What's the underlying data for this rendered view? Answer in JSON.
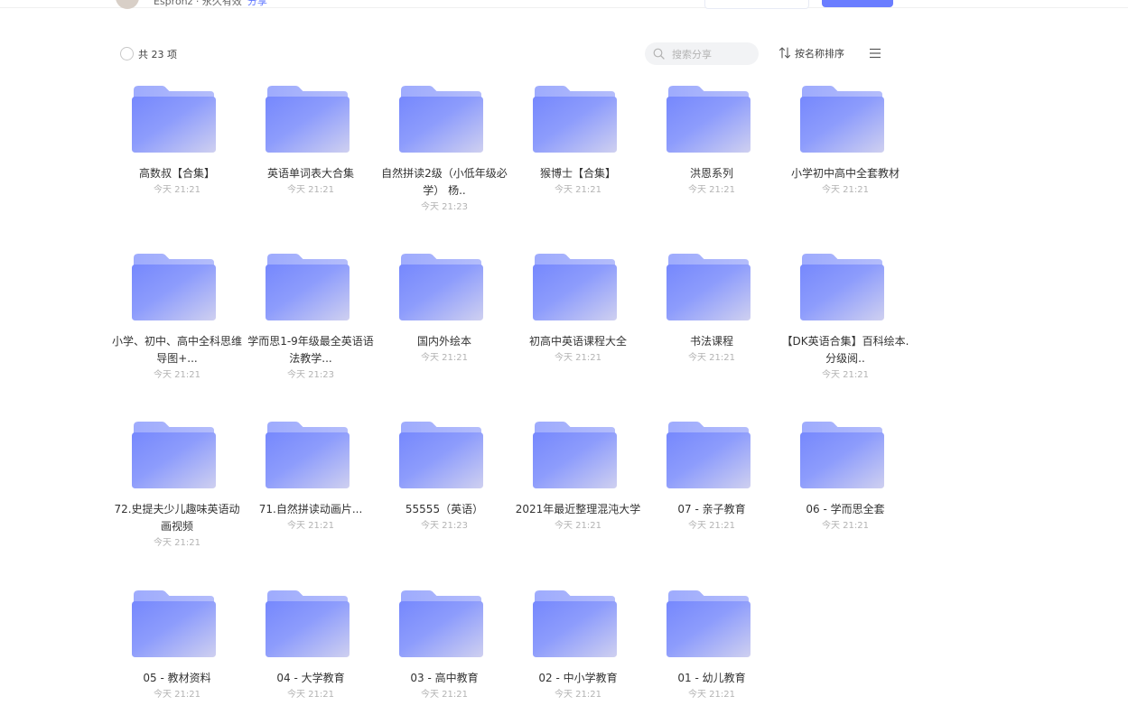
{
  "header": {
    "user_text": "Espronz · 永久有效",
    "link": "分享"
  },
  "toolbar": {
    "count": "共 23 项",
    "search_placeholder": "搜索分享",
    "sort_label": "按名称排序"
  },
  "colors": {
    "accent": "#6a7dff",
    "folder_light": "#a7b3fd",
    "folder_main": "#7e8ffd",
    "folder_end": "#c9cdf2"
  },
  "items": [
    {
      "name": "高数叔【合集】",
      "time": "今天 21:21"
    },
    {
      "name": "英语单词表大合集",
      "time": "今天 21:21"
    },
    {
      "name": "自然拼读2级（小低年级必学） 杨..",
      "time": "今天 21:23"
    },
    {
      "name": "猴博士【合集】",
      "time": "今天 21:21"
    },
    {
      "name": "洪恩系列",
      "time": "今天 21:21"
    },
    {
      "name": "小学初中高中全套教材",
      "time": "今天 21:21"
    },
    {
      "name": "小学、初中、高中全科思维导图+...",
      "time": "今天 21:21"
    },
    {
      "name": "学而思1-9年级最全英语语法教学...",
      "time": "今天 21:23"
    },
    {
      "name": "国内外绘本",
      "time": "今天 21:21"
    },
    {
      "name": "初高中英语课程大全",
      "time": "今天 21:21"
    },
    {
      "name": "书法课程",
      "time": "今天 21:21"
    },
    {
      "name": "【DK英语合集】百科绘本.分级阅..",
      "time": "今天 21:21"
    },
    {
      "name": "72.史提夫少儿趣味英语动画视频",
      "time": "今天 21:21"
    },
    {
      "name": "71.自然拼读动画片...",
      "time": "今天 21:21"
    },
    {
      "name": "55555（英语）",
      "time": "今天 21:23"
    },
    {
      "name": "2021年最近整理混沌大学",
      "time": "今天 21:21"
    },
    {
      "name": "07 - 亲子教育",
      "time": "今天 21:21"
    },
    {
      "name": "06 - 学而思全套",
      "time": "今天 21:21"
    },
    {
      "name": "05 - 教材资料",
      "time": "今天 21:21"
    },
    {
      "name": "04 - 大学教育",
      "time": "今天 21:21"
    },
    {
      "name": "03 - 高中教育",
      "time": "今天 21:21"
    },
    {
      "name": "02 - 中小学教育",
      "time": "今天 21:21"
    },
    {
      "name": "01 - 幼儿教育",
      "time": "今天 21:21"
    }
  ]
}
